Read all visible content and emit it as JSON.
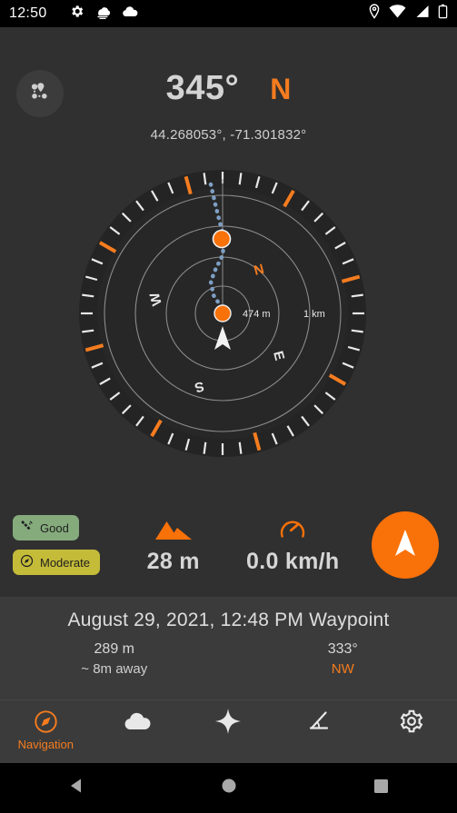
{
  "statusbar": {
    "clock": "12:50",
    "left_icons": [
      "gear-icon",
      "fog-cloud-icon",
      "cloud-icon"
    ],
    "right_icons": [
      "location-pin-icon",
      "wifi-icon",
      "cell-signal-icon",
      "battery-icon"
    ]
  },
  "header": {
    "route_button_icon": "route-waypoints-icon",
    "heading_degrees": "345°",
    "heading_cardinal": "N",
    "coordinates": "44.268053°,  -71.301832°"
  },
  "radar": {
    "scale_inner_label": "474 m",
    "scale_outer_label": "1 km",
    "cardinals": [
      {
        "label": "N",
        "color": "#f57c1f"
      },
      {
        "label": "E",
        "color": "#e8e8e8"
      },
      {
        "label": "S",
        "color": "#e8e8e8"
      },
      {
        "label": "W",
        "color": "#e8e8e8"
      }
    ],
    "rotation_degrees": -15,
    "position_marker": "user-position-arrow",
    "waypoint_count": 2,
    "track_style": "dotted"
  },
  "metrics": {
    "chips": [
      {
        "label": "Good",
        "icon": "satellite-icon",
        "color": "#85ab7d"
      },
      {
        "label": "Moderate",
        "icon": "compass-icon",
        "color": "#c4bb39"
      }
    ],
    "altitude": {
      "value": "28 m",
      "icon": "mountain-icon"
    },
    "speed": {
      "value": "0.0 km/h",
      "icon": "speedometer-icon"
    },
    "fab_icon": "navigation-arrow-icon"
  },
  "waypoint": {
    "title": "August 29, 2021, 12:48 PM Waypoint",
    "distance": "289 m",
    "distance_sub": "~ 8m away",
    "bearing": "333°",
    "bearing_sub": "NW"
  },
  "bottomnav": {
    "items": [
      {
        "label": "Navigation",
        "icon": "compass-icon",
        "active": true
      },
      {
        "label": "",
        "icon": "cloud-icon",
        "active": false
      },
      {
        "label": "",
        "icon": "star-icon",
        "active": false
      },
      {
        "label": "",
        "icon": "inclinometer-icon",
        "active": false
      },
      {
        "label": "",
        "icon": "gear-icon",
        "active": false
      }
    ]
  },
  "sysnav": {
    "back": "back-triangle-icon",
    "home": "home-circle-icon",
    "recents": "recents-square-icon"
  },
  "colors": {
    "accent": "#f57c1f",
    "background": "#303030",
    "panel": "#3b3b3b",
    "text": "#d6d6d6"
  }
}
